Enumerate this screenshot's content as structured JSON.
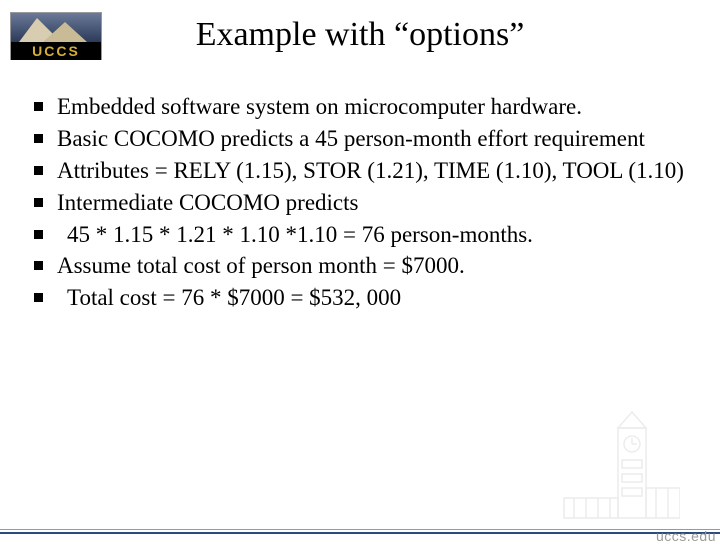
{
  "logo": {
    "text": "UCCS"
  },
  "title": "Example with “options”",
  "bullets": [
    "Embedded software system on microcomputer hardware.",
    "Basic COCOMO predicts a 45 person-month effort requirement",
    "Attributes = RELY (1.15), STOR (1.21), TIME (1.10), TOOL (1.10)",
    "Intermediate COCOMO predicts",
    "  45 * 1.15 * 1.21 * 1.10 *1.10 = 76 person-months.",
    "Assume total cost of person month = $7000.",
    " Total cost = 76 * $7000 = $532, 000"
  ],
  "footer": {
    "url": "uccs.edu"
  }
}
